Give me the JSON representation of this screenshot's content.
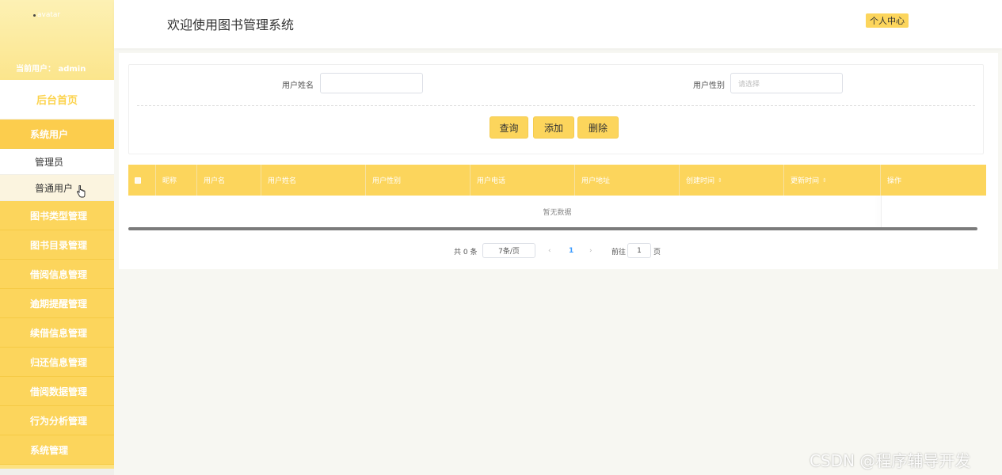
{
  "sidebar": {
    "avatar_alt": "avatar",
    "current_user": "当前用户：  admin",
    "home_label": "后台首页",
    "groups": [
      {
        "label": "系统用户"
      },
      {
        "label": "图书类型管理"
      },
      {
        "label": "图书目录管理"
      },
      {
        "label": "借阅信息管理"
      },
      {
        "label": "逾期提醒管理"
      },
      {
        "label": "续借信息管理"
      },
      {
        "label": "归还信息管理"
      },
      {
        "label": "借阅数据管理"
      },
      {
        "label": "行为分析管理"
      },
      {
        "label": "系统管理"
      }
    ],
    "sub_items": [
      {
        "label": "管理员"
      },
      {
        "label": "普通用户"
      }
    ]
  },
  "header": {
    "title": "欢迎使用图书管理系统",
    "profile_label": "个人中心"
  },
  "search": {
    "name_label": "用户姓名",
    "name_value": "",
    "gender_label": "用户性别",
    "gender_placeholder": "请选择",
    "query_button": "查询",
    "add_button": "添加",
    "delete_button": "删除"
  },
  "table": {
    "columns": [
      "昵称",
      "用户名",
      "用户姓名",
      "用户性别",
      "用户电话",
      "用户地址",
      "创建时间",
      "更新时间",
      "操作"
    ],
    "sortable_icon": "sort-icon",
    "empty_text": "暂无数据"
  },
  "pagination": {
    "total_text": "共 0 条",
    "page_size": "7条/页",
    "current_page": "1",
    "goto_prefix": "前往",
    "goto_value": "1",
    "goto_suffix": "页"
  },
  "watermark": "CSDN @程序辅导开发",
  "colors": {
    "accent": "#fcd55c",
    "sidebar_bg": "#fde280"
  }
}
